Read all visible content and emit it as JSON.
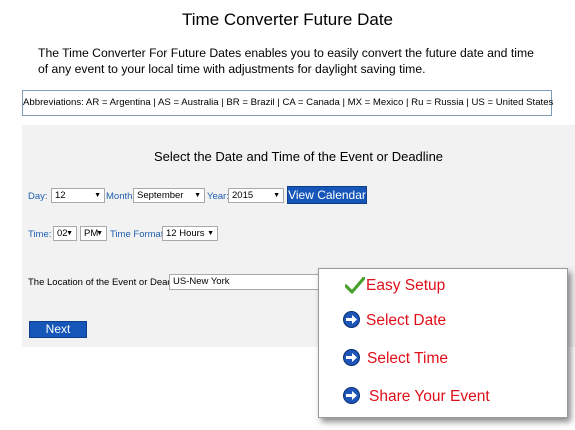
{
  "page": {
    "title": "Time Converter Future Date",
    "intro_line1": "The Time Converter For Future Dates enables you to easily convert the future date and time",
    "intro_line2": "of any event to your local time with adjustments for daylight saving time.",
    "abbreviations": "Abbreviations: AR = Argentina | AS = Australia | BR = Brazil | CA = Canada | MX = Mexico | Ru = Russia | US = United States"
  },
  "form": {
    "heading": "Select the Date and Time of the Event or Deadline",
    "day_label": "Day:",
    "day_value": "12",
    "month_label": "Month:",
    "month_value": "September",
    "year_label": "Year:",
    "year_value": "2015",
    "view_calendar_label": "View Calendar",
    "time_label": "Time:",
    "hour_value": "02",
    "ampm_value": "PM",
    "time_format_label": "Time Format:",
    "time_format_value": "12 Hours",
    "location_label": "The Location of the Event or Deadline:",
    "location_value": "US-New York",
    "next_label": "Next"
  },
  "card": {
    "items": [
      {
        "label": "Easy Setup",
        "icon": "checkmark-icon"
      },
      {
        "label": "Select Date",
        "icon": "arrow-circle-icon"
      },
      {
        "label": "Select Time",
        "icon": "arrow-circle-icon"
      },
      {
        "label": "Share Your Event",
        "icon": "arrow-circle-icon"
      }
    ]
  },
  "colors": {
    "accent_blue": "#1556b8",
    "label_blue": "#1f5fb0",
    "card_red": "#e0101a",
    "check_green": "#4aa02c",
    "panel_bg": "#f2f2f2"
  }
}
